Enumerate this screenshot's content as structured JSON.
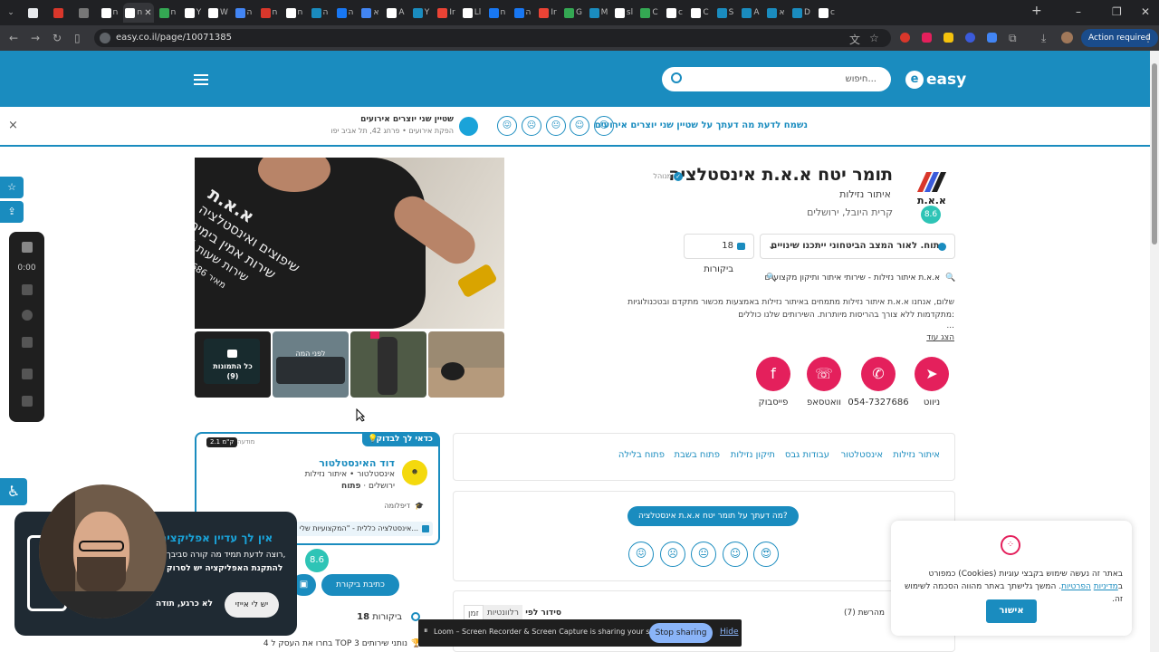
{
  "browser": {
    "tabs": [
      {
        "t": "",
        "c": "#e8eaed"
      },
      {
        "t": "",
        "c": "#d9372b"
      },
      {
        "t": "",
        "c": "#777"
      },
      {
        "t": "ח",
        "c": "#fff"
      },
      {
        "t": "ח",
        "c": "#fff",
        "active": true
      },
      {
        "t": "ח",
        "c": "#34a853"
      },
      {
        "t": "Y",
        "c": "#fff"
      },
      {
        "t": "W",
        "c": "#fff"
      },
      {
        "t": "ה",
        "c": "#4285f4"
      },
      {
        "t": "ח",
        "c": "#d9372b"
      },
      {
        "t": "ח",
        "c": "#fff"
      },
      {
        "t": "ה",
        "c": "#1a8cbf"
      },
      {
        "t": "ה",
        "c": "#1877f2"
      },
      {
        "t": "א",
        "c": "#4285f4"
      },
      {
        "t": "A",
        "c": "#fff"
      },
      {
        "t": "Y",
        "c": "#1a8cbf"
      },
      {
        "t": "Ir",
        "c": "#ea4335"
      },
      {
        "t": "Ll",
        "c": "#fff"
      },
      {
        "t": "ח",
        "c": "#1877f2"
      },
      {
        "t": "ה",
        "c": "#1877f2"
      },
      {
        "t": "Ir",
        "c": "#ea4335"
      },
      {
        "t": "G",
        "c": "#34a853"
      },
      {
        "t": "M",
        "c": "#1a8cbf"
      },
      {
        "t": "sl",
        "c": "#fff"
      },
      {
        "t": "C",
        "c": "#34a853"
      },
      {
        "t": "c",
        "c": "#fff"
      },
      {
        "t": "C",
        "c": "#fff"
      },
      {
        "t": "S",
        "c": "#1a8cbf"
      },
      {
        "t": "A",
        "c": "#1a8cbf"
      },
      {
        "t": "א",
        "c": "#1a8cbf"
      },
      {
        "t": "D",
        "c": "#1a8cbf"
      },
      {
        "t": "c",
        "c": "#fff"
      }
    ],
    "url": "easy.co.il/page/10071385",
    "action_required": "Action required"
  },
  "header": {
    "search_placeholder": "חיפוש...",
    "logo_text": "easy",
    "logo_letter": "e"
  },
  "survey": {
    "question": "נשמח לדעת מה דעתך על שטיין שני יוצרים אירועים",
    "business_name": "שטיין שני יוצרים אירועים",
    "business_sub": "הפקת אירועים • פרחג 42, תל אביב יפו",
    "close": "×"
  },
  "business": {
    "name": "תומר יטח א.א.ת אינסטלציה",
    "verified": "מנוהל",
    "category": "איתור נזילות",
    "location": "קרית היובל, ירושלים",
    "rating": "8.6",
    "logo_text": "א.א.ת",
    "open_status": "פתוח. לאור המצב הביטחוני ייתכנו שינויים",
    "reviews_btn": "18 ביקורות",
    "tagline": "א.א.ת איתור נזילות - שירותי איתור ותיקון מקצועיים",
    "desc1": "שלום, אנחנו א.א.ת איתור נזילות מתמחים באיתור נזילות באמצעות מכשור מתקדם ובטכנולוגיות",
    "desc2": "מתקדמות ללא צורך בהריסות מיותרות. השירותים שלנו כוללים:",
    "ellipsis": "...",
    "show_more": "הצג עוד",
    "actions": [
      {
        "label": "ניווט",
        "glyph": "➤"
      },
      {
        "label": "054-7327686",
        "glyph": "✆"
      },
      {
        "label": "וואטסאפ",
        "glyph": "☏"
      },
      {
        "label": "פייסבוק",
        "glyph": "f"
      }
    ]
  },
  "gallery": {
    "all_photos": "כל התמונות",
    "count": "(9)",
    "before": "לפני המה",
    "shirt_line1": "א.א.ת",
    "shirt_line2": "שיפוצים ואינסטלציה",
    "shirt_line3": "שירות אמין בימים",
    "shirt_line4": "שירות שעות 24",
    "shirt_line5": "מאיר 7327686"
  },
  "chips": [
    "איתור נזילות",
    "אינסטלטור",
    "עבודות גבס",
    "תיקון נזילות",
    "פתוח בשבת",
    "פתוח בלילה"
  ],
  "recommend": {
    "badge": "כדאי לך לבדוק",
    "promoted": "מודעה",
    "distance": "2.1 ק\"מ",
    "name": "דוד האינסטלטור",
    "sub": "אינסטלטור • איתור נזילות",
    "loc": "ירושלים · ",
    "open": "פתוח",
    "diploma": "דיפלומה",
    "quote": "אינסטלציה כללית - \"המקצועיות שלי..."
  },
  "review_prompt": {
    "text": "מה דעתך על תומר יטח א.א.ת אינסטלציה?"
  },
  "reviews": {
    "rating": "8.6",
    "write": "כתיבת ביקורת",
    "count_num": "18",
    "count_lbl": "ביקורות",
    "top": "4 בחרו את העסק ל TOP 3 נותני שירותים",
    "sort_label": "סידור לפי",
    "sort_opt1": "רלוונטיות",
    "sort_opt2": "זמן",
    "newest": "מהרשת (7)"
  },
  "app_popup": {
    "title": "אין לך עדיין אפליקציה",
    "line1": "רוצה לדעת תמיד מה קורה סביבך,",
    "line2": "להתקנת האפליקציה יש לסרוק",
    "yes": "יש לי אייזי",
    "no": "לא כרגע, תודה"
  },
  "cookie": {
    "text1": "באתר זה נעשה שימוש בקבצי עוגיות (Cookies) כמפורט ב",
    "link1": "מדיניות",
    "link2": "הפרטיות",
    "text2": ". המשך גלישתך באתר מהווה הסכמה לשימוש זה.",
    "ok": "אישור"
  },
  "loom": {
    "text": "Loom – Screen Recorder & Screen Capture is sharing your screen.",
    "stop": "Stop sharing",
    "hide": "Hide"
  },
  "recorder": {
    "timer": "0:00"
  },
  "colors": {
    "brand": "#1a8cbf",
    "accent": "#e4205c",
    "teal": "#2ec4b6",
    "cookie_btn": "#1a8cbf"
  }
}
